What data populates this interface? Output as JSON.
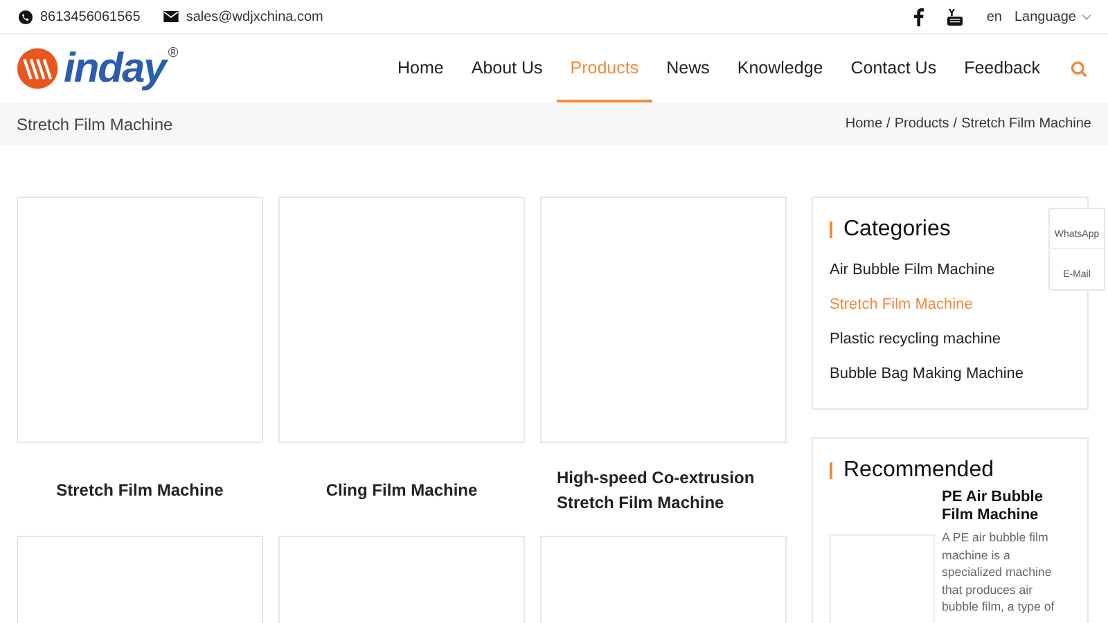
{
  "topbar": {
    "phone": "8613456061565",
    "email": "sales@wdjxchina.com",
    "lang_code": "en",
    "language": "Language"
  },
  "logo": {
    "text": "inday",
    "mark": "®"
  },
  "nav": [
    {
      "label": "Home",
      "selected": false
    },
    {
      "label": "About Us",
      "selected": false
    },
    {
      "label": "Products",
      "selected": true
    },
    {
      "label": "News",
      "selected": false
    },
    {
      "label": "Knowledge",
      "selected": false
    },
    {
      "label": "Contact Us",
      "selected": false
    },
    {
      "label": "Feedback",
      "selected": false
    }
  ],
  "page_title": "Stretch Film Machine",
  "breadcrumb": {
    "separator": "/",
    "items": [
      "Home",
      "Products",
      "Stretch Film Machine"
    ]
  },
  "products": [
    {
      "kind": "titled",
      "title": "Stretch Film Machine"
    },
    {
      "kind": "titled",
      "title": "Cling Film Machine"
    },
    {
      "kind": "titled",
      "title": "High-speed Co-extrusion Stretch Film Machine"
    },
    {
      "kind": "image-only"
    },
    {
      "kind": "image-only"
    },
    {
      "kind": "image-only"
    }
  ],
  "categories": {
    "title": "Categories",
    "items": [
      {
        "label": "Air Bubble Film Machine",
        "selected": false
      },
      {
        "label": "Stretch Film Machine",
        "selected": true
      },
      {
        "label": "Plastic recycling machine",
        "selected": false
      },
      {
        "label": "Bubble Bag Making Machine",
        "selected": false
      }
    ]
  },
  "recommended": {
    "title": "Recommended",
    "items": [
      {
        "title": "PE Air Bubble Film Machine",
        "description": "A PE air bubble film machine is a specialized machine that produces air bubble film, a type of"
      }
    ]
  },
  "float_widget": [
    "WhatsApp",
    "E-Mail"
  ]
}
